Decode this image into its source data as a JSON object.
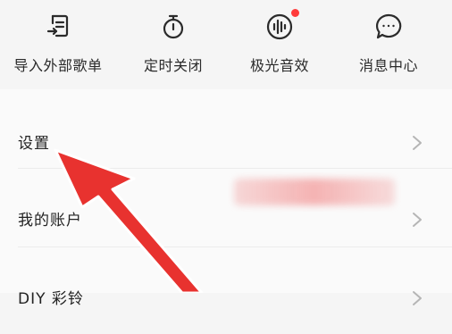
{
  "quick_actions": [
    {
      "label": "导入外部歌单",
      "icon": "import-playlist-icon"
    },
    {
      "label": "定时关闭",
      "icon": "timer-icon"
    },
    {
      "label": "极光音效",
      "icon": "sound-effect-icon",
      "badge": "red-dot"
    },
    {
      "label": "消息中心",
      "icon": "message-icon"
    }
  ],
  "settings_list": [
    {
      "label": "设置"
    },
    {
      "label": "我的账户"
    },
    {
      "label": "DIY 彩铃"
    }
  ],
  "colors": {
    "accent_red": "#e8322f",
    "badge_red": "#ff3b3b",
    "text": "#222222",
    "chevron": "#b5b5b5"
  }
}
